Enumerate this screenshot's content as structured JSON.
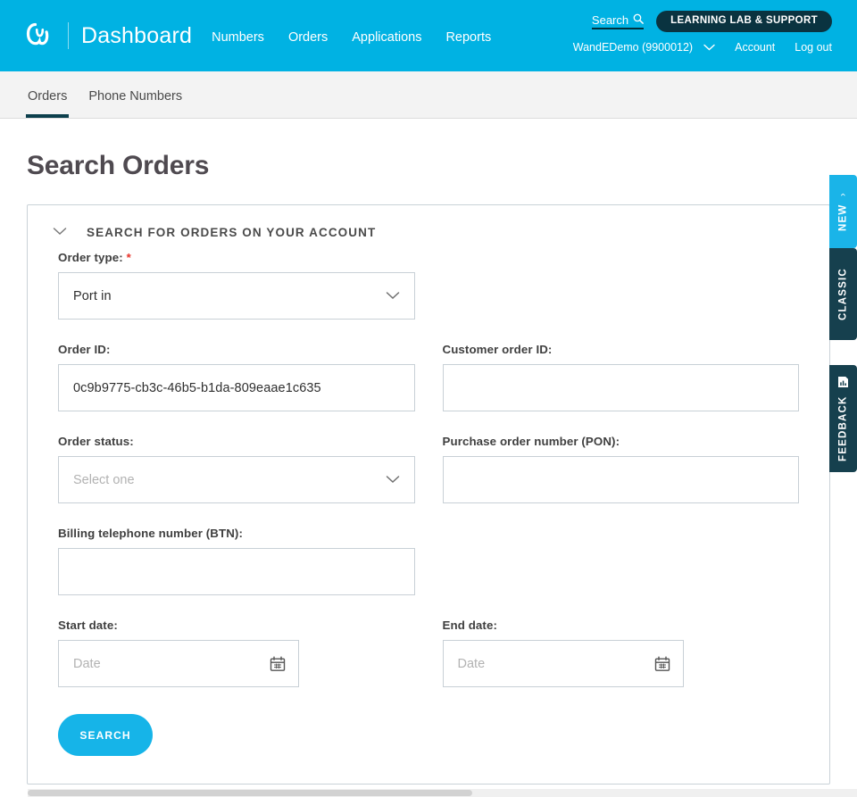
{
  "header": {
    "brand": "Dashboard",
    "logo_icon": "omega-logo-icon",
    "nav": [
      {
        "label": "Numbers"
      },
      {
        "label": "Orders"
      },
      {
        "label": "Applications"
      },
      {
        "label": "Reports"
      }
    ],
    "search_label": "Search",
    "search_icon": "search-icon",
    "support_pill": "LEARNING LAB & SUPPORT",
    "account_name": "WandEDemo (9900012)",
    "account_caret_icon": "chevron-down-icon",
    "account_link": "Account",
    "logout_link": "Log out",
    "bg_color": "#00b2e3",
    "pill_color": "#0a3340"
  },
  "subnav": {
    "tabs": [
      {
        "label": "Orders",
        "active": true
      },
      {
        "label": "Phone Numbers",
        "active": false
      }
    ],
    "active_underline_color": "#0c3f4c"
  },
  "page": {
    "title": "Search Orders"
  },
  "panel": {
    "collapse_icon": "chevron-down-icon",
    "title": "SEARCH FOR ORDERS ON YOUR ACCOUNT"
  },
  "form": {
    "order_type": {
      "label": "Order type:",
      "required_marker": "*",
      "value": "Port in",
      "caret_icon": "chevron-down-icon"
    },
    "order_id": {
      "label": "Order ID:",
      "value": "0c9b9775-cb3c-46b5-b1da-809eaae1c635",
      "placeholder": ""
    },
    "customer_order_id": {
      "label": "Customer order ID:",
      "value": "",
      "placeholder": ""
    },
    "order_status": {
      "label": "Order status:",
      "value": "",
      "placeholder": "Select one",
      "caret_icon": "chevron-down-icon"
    },
    "pon": {
      "label": "Purchase order number (PON):",
      "value": "",
      "placeholder": ""
    },
    "btn": {
      "label": "Billing telephone number (BTN):",
      "value": "",
      "placeholder": ""
    },
    "start_date": {
      "label": "Start date:",
      "value": "",
      "placeholder": "Date",
      "calendar_icon": "calendar-icon"
    },
    "end_date": {
      "label": "End date:",
      "value": "",
      "placeholder": "Date",
      "calendar_icon": "calendar-icon"
    },
    "search_button": "SEARCH",
    "search_button_color": "#16b4e8",
    "required_color": "#e8352c"
  },
  "sidetabs": [
    {
      "label": "NEW",
      "icon": "chevron-right-icon",
      "color": "#1ab4e8"
    },
    {
      "label": "CLASSIC",
      "icon": "",
      "color": "#16404e"
    },
    {
      "label": "FEEDBACK",
      "icon": "chart-document-icon",
      "color": "#16404e"
    }
  ]
}
